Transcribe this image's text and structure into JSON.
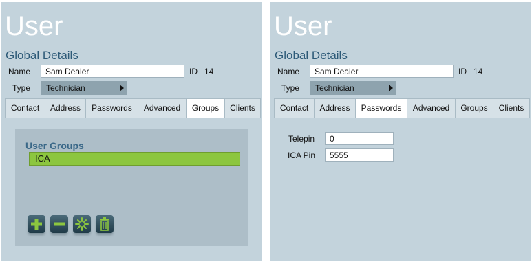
{
  "left": {
    "title": "User",
    "section": "Global Details",
    "name_label": "Name",
    "name_value": "Sam Dealer",
    "id_label": "ID",
    "id_value": "14",
    "type_label": "Type",
    "type_value": "Technician",
    "tabs": [
      {
        "label": "Contact"
      },
      {
        "label": "Address"
      },
      {
        "label": "Passwords"
      },
      {
        "label": "Advanced"
      },
      {
        "label": "Groups"
      },
      {
        "label": "Clients"
      }
    ],
    "active_tab": "Groups",
    "groups": {
      "title": "User Groups",
      "items": [
        {
          "label": "ICA"
        }
      ],
      "toolbar": [
        "add-icon",
        "remove-icon",
        "sparkle-icon",
        "trash-icon"
      ]
    }
  },
  "right": {
    "title": "User",
    "section": "Global Details",
    "name_label": "Name",
    "name_value": "Sam Dealer",
    "id_label": "ID",
    "id_value": "14",
    "type_label": "Type",
    "type_value": "Technician",
    "tabs": [
      {
        "label": "Contact"
      },
      {
        "label": "Address"
      },
      {
        "label": "Passwords"
      },
      {
        "label": "Advanced"
      },
      {
        "label": "Groups"
      },
      {
        "label": "Clients"
      }
    ],
    "active_tab": "Passwords",
    "passwords": {
      "telepin_label": "Telepin",
      "telepin_value": "0",
      "ica_pin_label": "ICA Pin",
      "ica_pin_value": "5555"
    }
  },
  "colors": {
    "panel_bg": "#c3d3dc",
    "title": "#ffffff",
    "section_title": "#2d5a78",
    "group_item": "#8cc63f",
    "type_select": "#8ea3ae"
  }
}
